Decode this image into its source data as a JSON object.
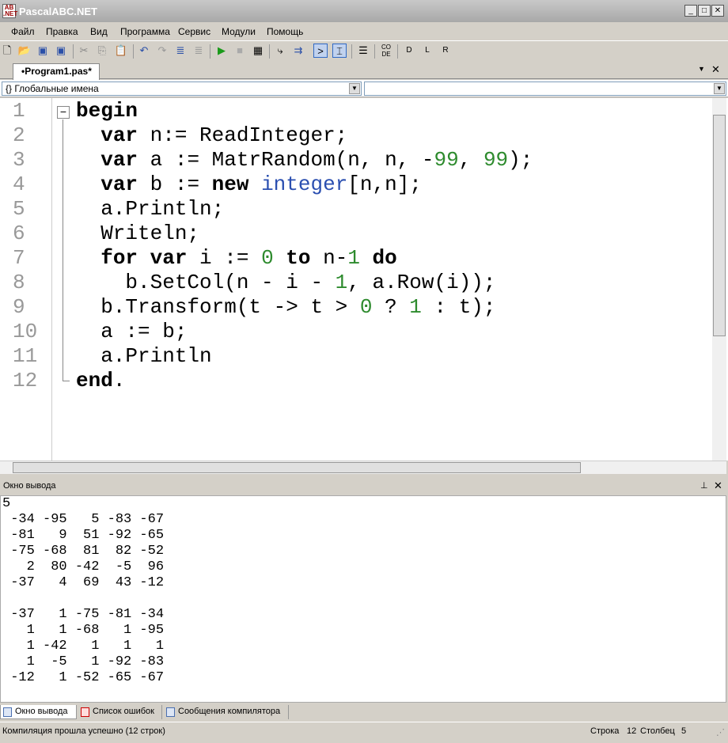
{
  "window": {
    "title": "PascalABC.NET",
    "logo": "AB.NET"
  },
  "menu": [
    "Файл",
    "Правка",
    "Вид",
    "Программа",
    "Сервис",
    "Модули",
    "Помощь"
  ],
  "toolbar_icons": [
    "new-file",
    "open",
    "save",
    "save-all",
    "cut",
    "copy",
    "paste",
    "undo",
    "redo",
    "format",
    "format2",
    "run",
    "stop",
    "compile",
    "step-into",
    "step-over",
    "console-output",
    "output-window",
    "navigator",
    "code-template",
    "debug-d",
    "debug-l",
    "debug-r"
  ],
  "tab": {
    "label": "•Program1.pas*"
  },
  "combos": {
    "left": "{} Глобальные имена",
    "right": ""
  },
  "code": [
    [
      {
        "t": "begin",
        "c": "kw"
      }
    ],
    [
      {
        "t": "  "
      },
      {
        "t": "var",
        "c": "kw"
      },
      {
        "t": " n:= ReadInteger;"
      }
    ],
    [
      {
        "t": "  "
      },
      {
        "t": "var",
        "c": "kw"
      },
      {
        "t": " a := MatrRandom(n, n, -"
      },
      {
        "t": "99",
        "c": "num"
      },
      {
        "t": ", "
      },
      {
        "t": "99",
        "c": "num"
      },
      {
        "t": ");"
      }
    ],
    [
      {
        "t": "  "
      },
      {
        "t": "var",
        "c": "kw"
      },
      {
        "t": " b := "
      },
      {
        "t": "new",
        "c": "kw"
      },
      {
        "t": " "
      },
      {
        "t": "integer",
        "c": "type"
      },
      {
        "t": "[n,n];"
      }
    ],
    [
      {
        "t": "  a.Println;"
      }
    ],
    [
      {
        "t": "  Writeln;"
      }
    ],
    [
      {
        "t": "  "
      },
      {
        "t": "for",
        "c": "kw"
      },
      {
        "t": " "
      },
      {
        "t": "var",
        "c": "kw"
      },
      {
        "t": " i := "
      },
      {
        "t": "0",
        "c": "num"
      },
      {
        "t": " "
      },
      {
        "t": "to",
        "c": "kw"
      },
      {
        "t": " n-"
      },
      {
        "t": "1",
        "c": "num"
      },
      {
        "t": " "
      },
      {
        "t": "do",
        "c": "kw"
      }
    ],
    [
      {
        "t": "    b.SetCol(n - i - "
      },
      {
        "t": "1",
        "c": "num"
      },
      {
        "t": ", a.Row(i));"
      }
    ],
    [
      {
        "t": "  b.Transform(t -> t > "
      },
      {
        "t": "0",
        "c": "num"
      },
      {
        "t": " ? "
      },
      {
        "t": "1",
        "c": "num"
      },
      {
        "t": " : t);"
      }
    ],
    [
      {
        "t": "  a := b;"
      }
    ],
    [
      {
        "t": "  a.Println"
      }
    ],
    [
      {
        "t": "end",
        "c": "kw"
      },
      {
        "t": "."
      }
    ]
  ],
  "output": {
    "title": "Окно вывода",
    "text": "5\n -34 -95   5 -83 -67\n -81   9  51 -92 -65\n -75 -68  81  82 -52\n   2  80 -42  -5  96\n -37   4  69  43 -12\n\n -37   1 -75 -81 -34\n   1   1 -68   1 -95\n   1 -42   1   1   1\n   1  -5   1 -92 -83\n -12   1 -52 -65 -67"
  },
  "bottom_tabs": [
    "Окно вывода",
    "Список ошибок",
    "Сообщения компилятора"
  ],
  "status": {
    "message": "Компиляция прошла успешно (12 строк)",
    "row_label": "Строка",
    "row": "12",
    "col_label": "Столбец",
    "col": "5"
  }
}
